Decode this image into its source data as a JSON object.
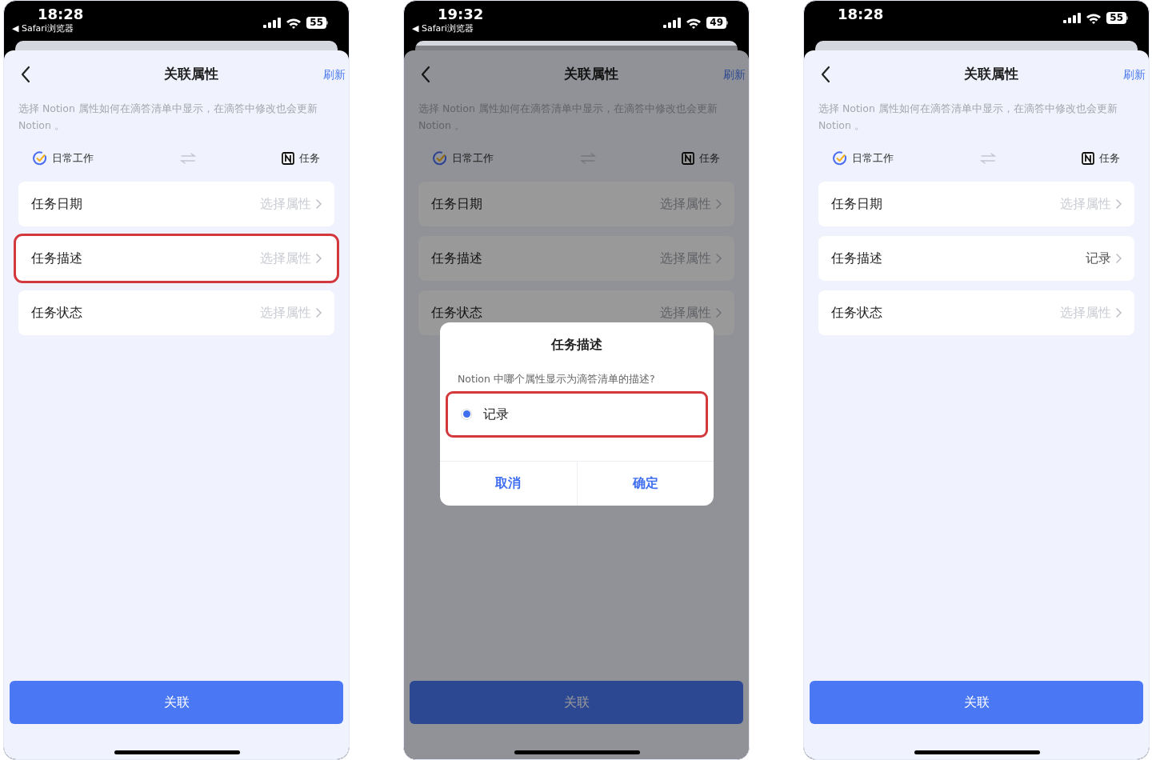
{
  "phones": [
    {
      "status_bar": {
        "time": "18:28",
        "back_link": "◀ Safari浏览器",
        "battery": "55"
      },
      "dimmed": false,
      "header": {
        "title": "关联属性",
        "action": "刷新"
      },
      "description": "选择 Notion 属性如何在滴答清单中显示，在滴答中修改也会更新 Notion 。",
      "mapping": {
        "left": "日常工作",
        "right": "任务"
      },
      "rows": [
        {
          "label": "任务日期",
          "value": "选择属性",
          "value_set": false,
          "highlighted": false
        },
        {
          "label": "任务描述",
          "value": "选择属性",
          "value_set": false,
          "highlighted": true
        },
        {
          "label": "任务状态",
          "value": "选择属性",
          "value_set": false,
          "highlighted": false
        }
      ],
      "primary_button": "关联"
    },
    {
      "status_bar": {
        "time": "19:32",
        "back_link": "◀ Safari浏览器",
        "battery": "49"
      },
      "dimmed": true,
      "header": {
        "title": "关联属性",
        "action": "刷新"
      },
      "description": "选择 Notion 属性如何在滴答清单中显示，在滴答中修改也会更新 Notion 。",
      "mapping": {
        "left": "日常工作",
        "right": "任务"
      },
      "rows": [
        {
          "label": "任务日期",
          "value": "选择属性",
          "value_set": false,
          "highlighted": false
        },
        {
          "label": "任务描述",
          "value": "选择属性",
          "value_set": false,
          "highlighted": false
        },
        {
          "label": "任务状态",
          "value": "选择属性",
          "value_set": false,
          "highlighted": false
        }
      ],
      "primary_button": "关联",
      "dialog": {
        "title": "任务描述",
        "question": "Notion 中哪个属性显示为滴答清单的描述?",
        "options": [
          {
            "label": "记录",
            "selected": true,
            "highlighted": true
          }
        ],
        "buttons": [
          "取消",
          "确定"
        ]
      }
    },
    {
      "status_bar": {
        "time": "18:28",
        "battery": "55"
      },
      "dimmed": false,
      "header": {
        "title": "关联属性",
        "action": "刷新"
      },
      "description": "选择 Notion 属性如何在滴答清单中显示，在滴答中修改也会更新 Notion 。",
      "mapping": {
        "left": "日常工作",
        "right": "任务"
      },
      "rows": [
        {
          "label": "任务日期",
          "value": "选择属性",
          "value_set": false,
          "highlighted": false
        },
        {
          "label": "任务描述",
          "value": "记录",
          "value_set": true,
          "highlighted": false
        },
        {
          "label": "任务状态",
          "value": "选择属性",
          "value_set": false,
          "highlighted": false
        }
      ],
      "primary_button": "关联"
    }
  ]
}
